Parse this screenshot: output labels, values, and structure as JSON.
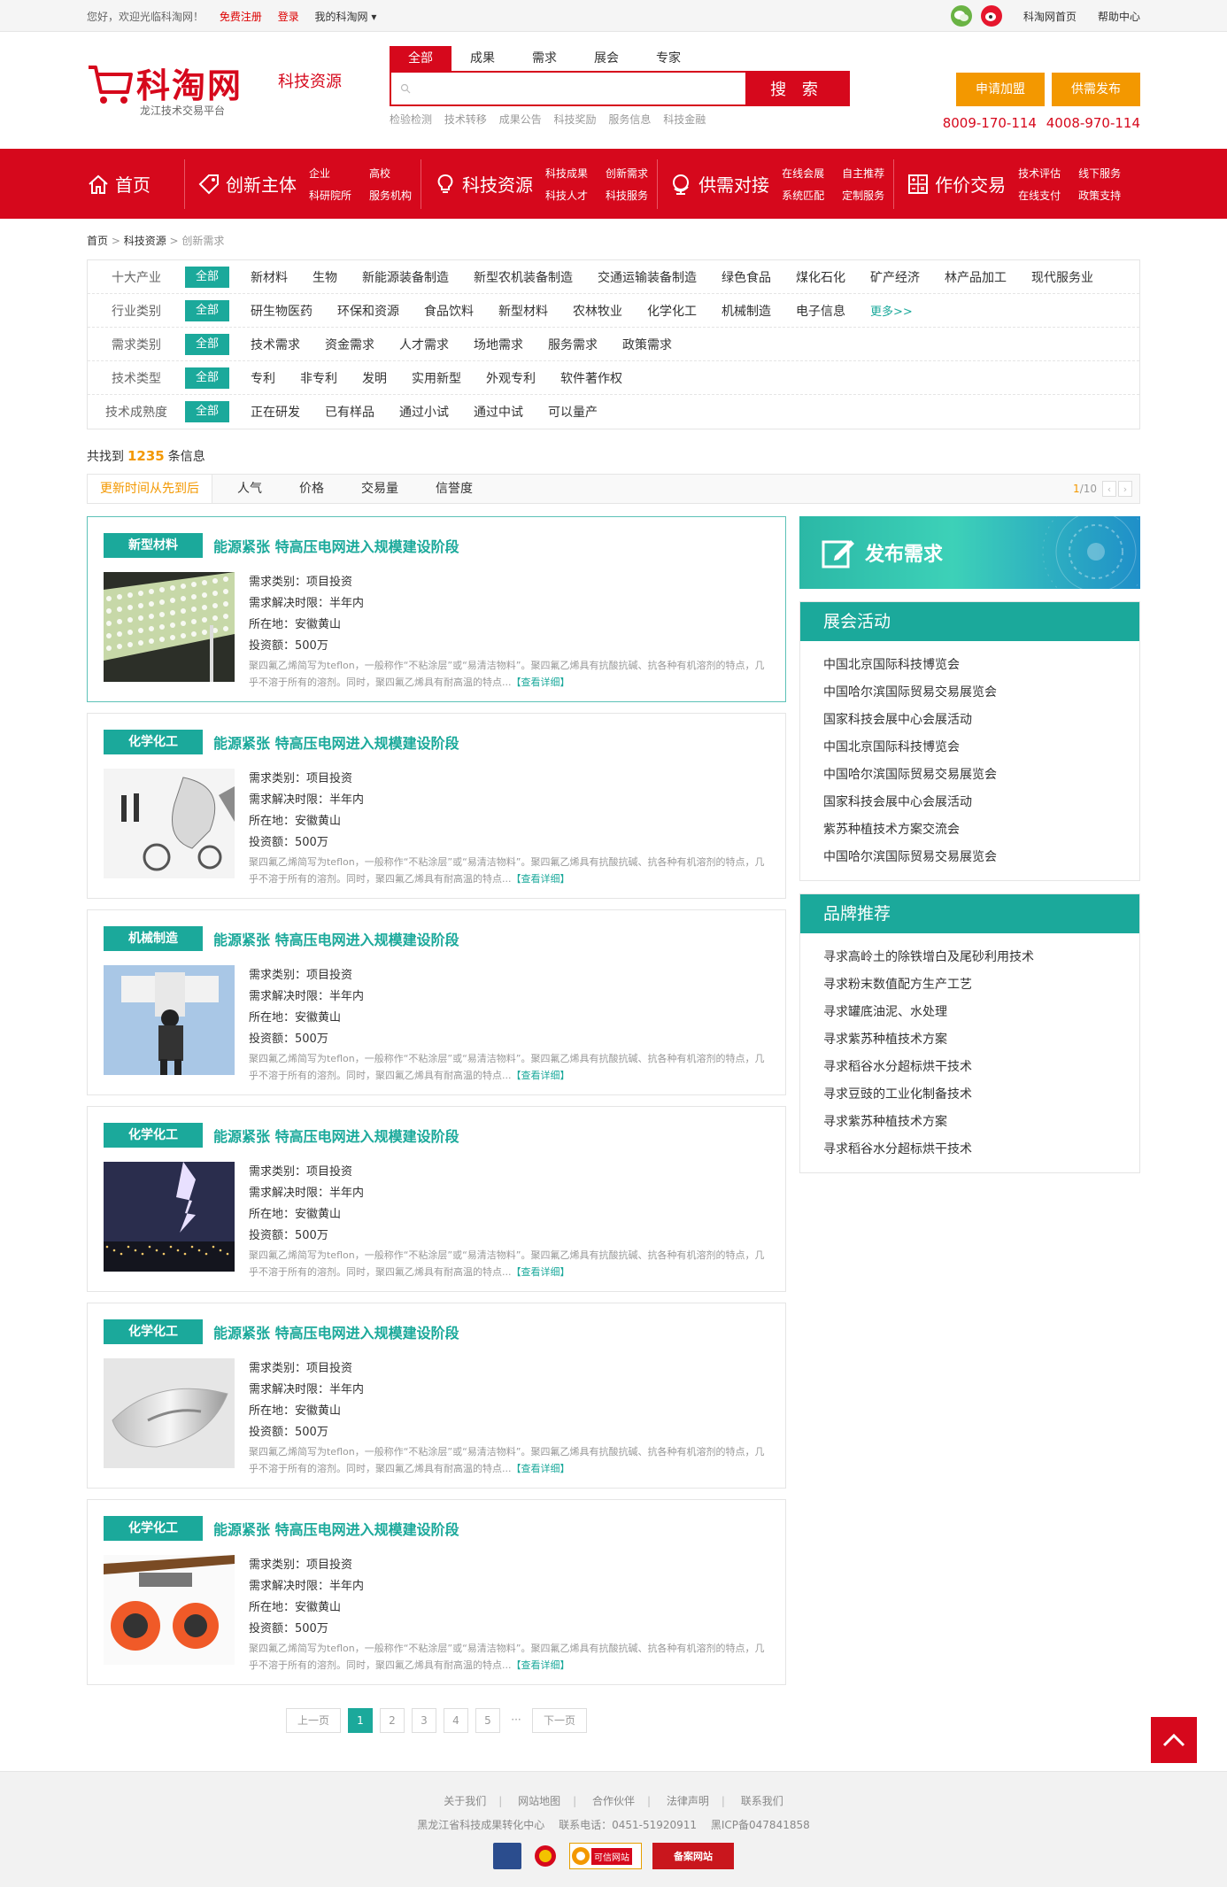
{
  "topbar": {
    "welcome": "您好，欢迎光临科淘网！",
    "register": "免费注册",
    "login": "登录",
    "my": "我的科淘网 ▾",
    "home_link": "科淘网首页",
    "help": "帮助中心"
  },
  "logo": {
    "name": "科淘网",
    "sub": "龙江技术交易平台",
    "tag": "科技资源"
  },
  "search": {
    "tabs": [
      "全部",
      "成果",
      "需求",
      "展会",
      "专家"
    ],
    "button": "搜 索",
    "keywords": [
      "检验检测",
      "技术转移",
      "成果公告",
      "科技奖励",
      "服务信息",
      "科技金融"
    ]
  },
  "header_buttons": [
    "申请加盟",
    "供需发布"
  ],
  "phones": "8009-170-114  4008-970-114",
  "nav": {
    "home": "首页",
    "groups": [
      {
        "title": "创新主体",
        "subs": [
          "企业",
          "高校",
          "科研院所",
          "服务机构"
        ]
      },
      {
        "title": "科技资源",
        "subs": [
          "科技成果",
          "创新需求",
          "科技人才",
          "科技服务"
        ]
      },
      {
        "title": "供需对接",
        "subs": [
          "在线会展",
          "自主推荐",
          "系统匹配",
          "定制服务"
        ]
      },
      {
        "title": "作价交易",
        "subs": [
          "技术评估",
          "线下服务",
          "在线支付",
          "政策支持"
        ]
      }
    ]
  },
  "breadcrumb": {
    "home": "首页",
    "sep1": " > ",
    "mid": "科技资源",
    "sep2": " > ",
    "cur": "创新需求"
  },
  "filters": [
    {
      "label": "十大产业",
      "all": "全部",
      "items": [
        "新材料",
        "生物",
        "新能源装备制造",
        "新型农机装备制造",
        "交通运输装备制造",
        "绿色食品",
        "煤化石化",
        "矿产经济",
        "林产品加工",
        "现代服务业"
      ]
    },
    {
      "label": "行业类别",
      "all": "全部",
      "items": [
        "研生物医药",
        "环保和资源",
        "食品饮料",
        "新型材料",
        "农林牧业",
        "化学化工",
        "机械制造",
        "电子信息"
      ],
      "more": "更多>>"
    },
    {
      "label": "需求类别",
      "all": "全部",
      "items": [
        "技术需求",
        "资金需求",
        "人才需求",
        "场地需求",
        "服务需求",
        "政策需求"
      ]
    },
    {
      "label": "技术类型",
      "all": "全部",
      "items": [
        "专利",
        "非专利",
        "发明",
        "实用新型",
        "外观专利",
        "软件著作权"
      ]
    },
    {
      "label": "技术成熟度",
      "all": "全部",
      "items": [
        "正在研发",
        "已有样品",
        "通过小试",
        "通过中试",
        "可以量产"
      ]
    }
  ],
  "count": {
    "pre": "共找到",
    "num": "1235",
    "post": "条信息"
  },
  "sort": {
    "items": [
      "更新时间从先到后",
      "人气",
      "价格",
      "交易量",
      "信誉度"
    ],
    "page_cur": "1",
    "page_total": "/10"
  },
  "items": [
    {
      "tag": "新型材料",
      "title": "能源紧张 特高压电网进入规模建设阶段",
      "type": "需求类别：项目投资",
      "limit": "需求解决时限：半年内",
      "loc": "所在地：安徽黄山",
      "invest": "投资额：500万",
      "desc": "聚四氟乙烯简写为teflon，一般称作“不粘涂层”或“易清洁物料”。聚四氟乙烯具有抗酸抗碱、抗各种有机溶剂的特点，几乎不溶于所有的溶剂。同时，聚四氟乙烯具有耐高温的特点...",
      "more": "【查看详细】",
      "img": "green-panel"
    },
    {
      "tag": "化学化工",
      "title": "能源紧张 特高压电网进入规模建设阶段",
      "type": "需求类别：项目投资",
      "limit": "需求解决时限：半年内",
      "loc": "所在地：安徽黄山",
      "invest": "投资额：500万",
      "desc": "聚四氟乙烯简写为teflon，一般称作“不粘涂层”或“易清洁物料”。聚四氟乙烯具有抗酸抗碱、抗各种有机溶剂的特点，几乎不溶于所有的溶剂。同时，聚四氟乙烯具有耐高温的特点...",
      "more": "【查看详细】",
      "img": "vehicle-sketch"
    },
    {
      "tag": "机械制造",
      "title": "能源紧张 特高压电网进入规模建设阶段",
      "type": "需求类别：项目投资",
      "limit": "需求解决时限：半年内",
      "loc": "所在地：安徽黄山",
      "invest": "投资额：500万",
      "desc": "聚四氟乙烯简写为teflon，一般称作“不粘涂层”或“易清洁物料”。聚四氟乙烯具有抗酸抗碱、抗各种有机溶剂的特点，几乎不溶于所有的溶剂。同时，聚四氟乙烯具有耐高温的特点...",
      "more": "【查看详细】",
      "img": "jetpack"
    },
    {
      "tag": "化学化工",
      "title": "能源紧张 特高压电网进入规模建设阶段",
      "type": "需求类别：项目投资",
      "limit": "需求解决时限：半年内",
      "loc": "所在地：安徽黄山",
      "invest": "投资额：500万",
      "desc": "聚四氟乙烯简写为teflon，一般称作“不粘涂层”或“易清洁物料”。聚四氟乙烯具有抗酸抗碱、抗各种有机溶剂的特点，几乎不溶于所有的溶剂。同时，聚四氟乙烯具有耐高温的特点...",
      "more": "【查看详细】",
      "img": "lightning"
    },
    {
      "tag": "化学化工",
      "title": "能源紧张 特高压电网进入规模建设阶段",
      "type": "需求类别：项目投资",
      "limit": "需求解决时限：半年内",
      "loc": "所在地：安徽黄山",
      "invest": "投资额：500万",
      "desc": "聚四氟乙烯简写为teflon，一般称作“不粘涂层”或“易清洁物料”。聚四氟乙烯具有抗酸抗碱、抗各种有机溶剂的特点，几乎不溶于所有的溶剂。同时，聚四氟乙烯具有耐高温的特点...",
      "more": "【查看详细】",
      "img": "silver-object"
    },
    {
      "tag": "化学化工",
      "title": "能源紧张 特高压电网进入规模建设阶段",
      "type": "需求类别：项目投资",
      "limit": "需求解决时限：半年内",
      "loc": "所在地：安徽黄山",
      "invest": "投资额：500万",
      "desc": "聚四氟乙烯简写为teflon，一般称作“不粘涂层”或“易清洁物料”。聚四氟乙烯具有抗酸抗碱、抗各种有机溶剂的特点，几乎不溶于所有的溶剂。同时，聚四氟乙烯具有耐高温的特点...",
      "more": "【查看详细】",
      "img": "skateboard"
    }
  ],
  "pager": {
    "prev": "上一页",
    "pages": [
      "1",
      "2",
      "3",
      "4",
      "5"
    ],
    "dots": "···",
    "next": "下一页"
  },
  "side": {
    "publish": "发布需求",
    "exhibit_title": "展会活动",
    "exhibits": [
      "中国北京国际科技博览会",
      "中国哈尔滨国际贸易交易展览会",
      "国家科技会展中心会展活动",
      "中国北京国际科技博览会",
      "中国哈尔滨国际贸易交易展览会",
      "国家科技会展中心会展活动",
      "紫苏种植技术方案交流会",
      "中国哈尔滨国际贸易交易展览会"
    ],
    "brand_title": "品牌推荐",
    "brands": [
      "寻求高岭土的除铁增白及尾砂利用技术",
      "寻求粉末数值配方生产工艺",
      "寻求罐底油泥、水处理",
      "寻求紫苏种植技术方案",
      "寻求稻谷水分超标烘干技术",
      "寻求豆豉的工业化制备技术",
      "寻求紫苏种植技术方案",
      "寻求稻谷水分超标烘干技术"
    ]
  },
  "footer": {
    "links": [
      "关于我们",
      "网站地图",
      "合作伙伴",
      "法律声明",
      "联系我们"
    ],
    "org": "黑龙江省科技成果转化中心",
    "tel": "联系电话：0451-51920911",
    "icp": "黑ICP备047841858",
    "badge1": "可信网站",
    "badge2": "备案网站"
  },
  "colors": {
    "brand_red": "#d6081c",
    "teal": "#1ba99b",
    "orange": "#f39800"
  }
}
